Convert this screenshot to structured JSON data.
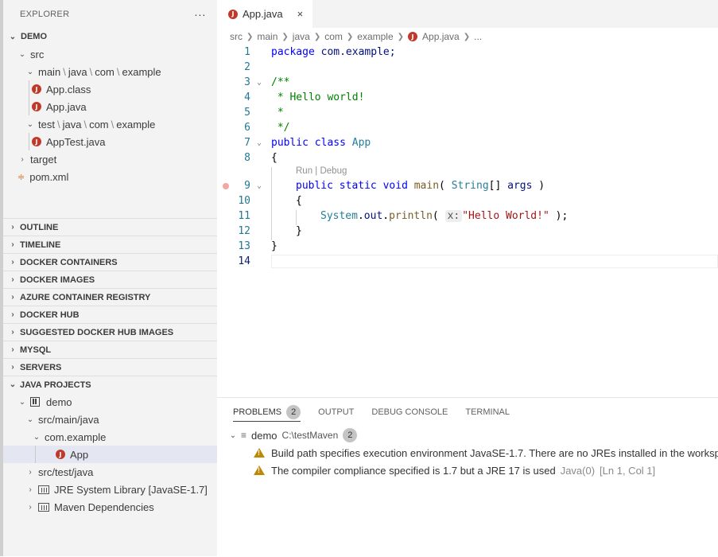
{
  "sidebar": {
    "title": "EXPLORER",
    "more": "···",
    "root": "DEMO",
    "tree": {
      "src": "src",
      "main_path": [
        "main",
        "java",
        "com",
        "example"
      ],
      "app_class": "App.class",
      "app_java": "App.java",
      "test_path": [
        "test",
        "java",
        "com",
        "example"
      ],
      "app_test": "AppTest.java",
      "target": "target",
      "pom": "pom.xml"
    },
    "sections": [
      "OUTLINE",
      "TIMELINE",
      "DOCKER CONTAINERS",
      "DOCKER IMAGES",
      "AZURE CONTAINER REGISTRY",
      "DOCKER HUB",
      "SUGGESTED DOCKER HUB IMAGES",
      "MYSQL",
      "SERVERS"
    ],
    "java_projects": {
      "title": "JAVA PROJECTS",
      "demo": "demo",
      "src_main": "src/main/java",
      "package": "com.example",
      "app": "App",
      "src_test": "src/test/java",
      "jre": "JRE System Library [JavaSE-1.7]",
      "maven": "Maven Dependencies"
    }
  },
  "editor": {
    "tab": {
      "label": "App.java",
      "close": "×"
    },
    "breadcrumb": [
      "src",
      "main",
      "java",
      "com",
      "example",
      "App.java",
      "..."
    ],
    "line_numbers": [
      "1",
      "2",
      "3",
      "4",
      "5",
      "6",
      "7",
      "8",
      "9",
      "10",
      "11",
      "12",
      "13",
      "14"
    ],
    "code": {
      "l1_kw": "package",
      "l1_rest": " com.example;",
      "l3": "/**",
      "l4": " * Hello world!",
      "l5": " *",
      "l6": " */",
      "l7_kw1": "public",
      "l7_kw2": "class",
      "l7_name": "App",
      "l8": "{",
      "codelens": "Run | Debug",
      "l9_kw1": "public",
      "l9_kw2": "static",
      "l9_kw3": "void",
      "l9_fn": "main",
      "l9_paren": "( ",
      "l9_type": "String",
      "l9_arr": "[] ",
      "l9_var": "args",
      "l9_close": " )",
      "l10": "{",
      "l11_cls": "System",
      "l11_dot1": ".",
      "l11_out": "out",
      "l11_dot2": ".",
      "l11_fn": "println",
      "l11_paren": "( ",
      "l11_hint": "x:",
      "l11_str": "\"Hello World!\"",
      "l11_close": " );",
      "l12": "}",
      "l13": "}"
    }
  },
  "panel": {
    "tabs": {
      "problems": "PROBLEMS",
      "problems_count": "2",
      "output": "OUTPUT",
      "debug": "DEBUG CONSOLE",
      "terminal": "TERMINAL"
    },
    "group": {
      "name": "demo",
      "path": "C:\\testMaven",
      "count": "2"
    },
    "problems": [
      {
        "message": "Build path specifies execution environment JavaSE-1.7. There are no JREs installed in the workspace",
        "source": "",
        "location": ""
      },
      {
        "message": "The compiler compliance specified is 1.7 but a JRE 17 is used",
        "source": "Java(0)",
        "location": "[Ln 1, Col 1]"
      }
    ]
  },
  "colors": {
    "accent_red": "#c0392b",
    "warning": "#bf8803",
    "keyword": "#0000ff",
    "comment": "#008000",
    "string": "#a31515"
  }
}
